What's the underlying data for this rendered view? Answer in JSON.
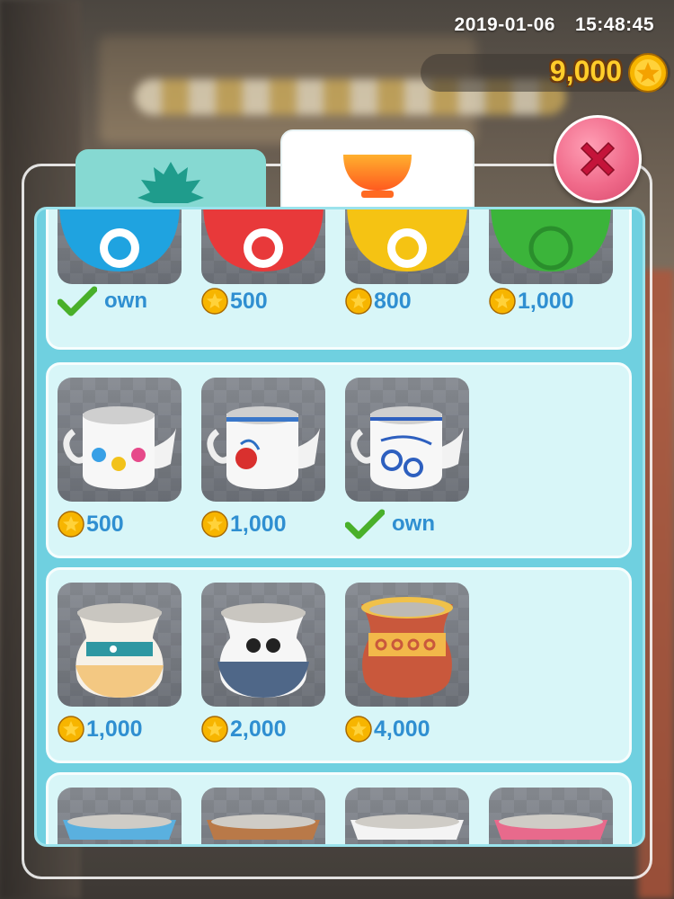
{
  "status_bar": {
    "date": "2019-01-06",
    "time": "15:48:45"
  },
  "wallet": {
    "coins": "9,000"
  },
  "tabs": [
    {
      "name": "herbs",
      "icon": "leaf-icon",
      "active": false
    },
    {
      "name": "bowls",
      "icon": "bowl-icon",
      "active": true
    }
  ],
  "colors": {
    "price_text": "#2f8fd1",
    "coin_text": "#ffcd2a",
    "panel_bg": "#6fd0e0",
    "row_bg": "#d8f6f8"
  },
  "shop": {
    "rows": [
      {
        "items": [
          {
            "item": "blue bowl",
            "label": "own",
            "owned": true
          },
          {
            "item": "red bowl",
            "label": "500",
            "owned": false
          },
          {
            "item": "yellow bowl",
            "label": "800",
            "owned": false
          },
          {
            "item": "green bowl",
            "label": "1,000",
            "owned": false
          }
        ]
      },
      {
        "items": [
          {
            "item": "white teapot",
            "label": "500",
            "owned": false
          },
          {
            "item": "red flower teapot",
            "label": "1,000",
            "owned": false
          },
          {
            "item": "blue porcelain teapot",
            "label": "own",
            "owned": true
          }
        ]
      },
      {
        "items": [
          {
            "item": "fish jar",
            "label": "1,000",
            "owned": false
          },
          {
            "item": "cat jar",
            "label": "2,000",
            "owned": false
          },
          {
            "item": "clay pot",
            "label": "4,000",
            "owned": false
          }
        ]
      },
      {
        "items": [
          {
            "item": "blue tray",
            "label": "",
            "owned": false
          },
          {
            "item": "wood tray",
            "label": "",
            "owned": false
          },
          {
            "item": "white tray",
            "label": "",
            "owned": false
          },
          {
            "item": "pink tray",
            "label": "",
            "owned": false
          }
        ]
      }
    ]
  }
}
